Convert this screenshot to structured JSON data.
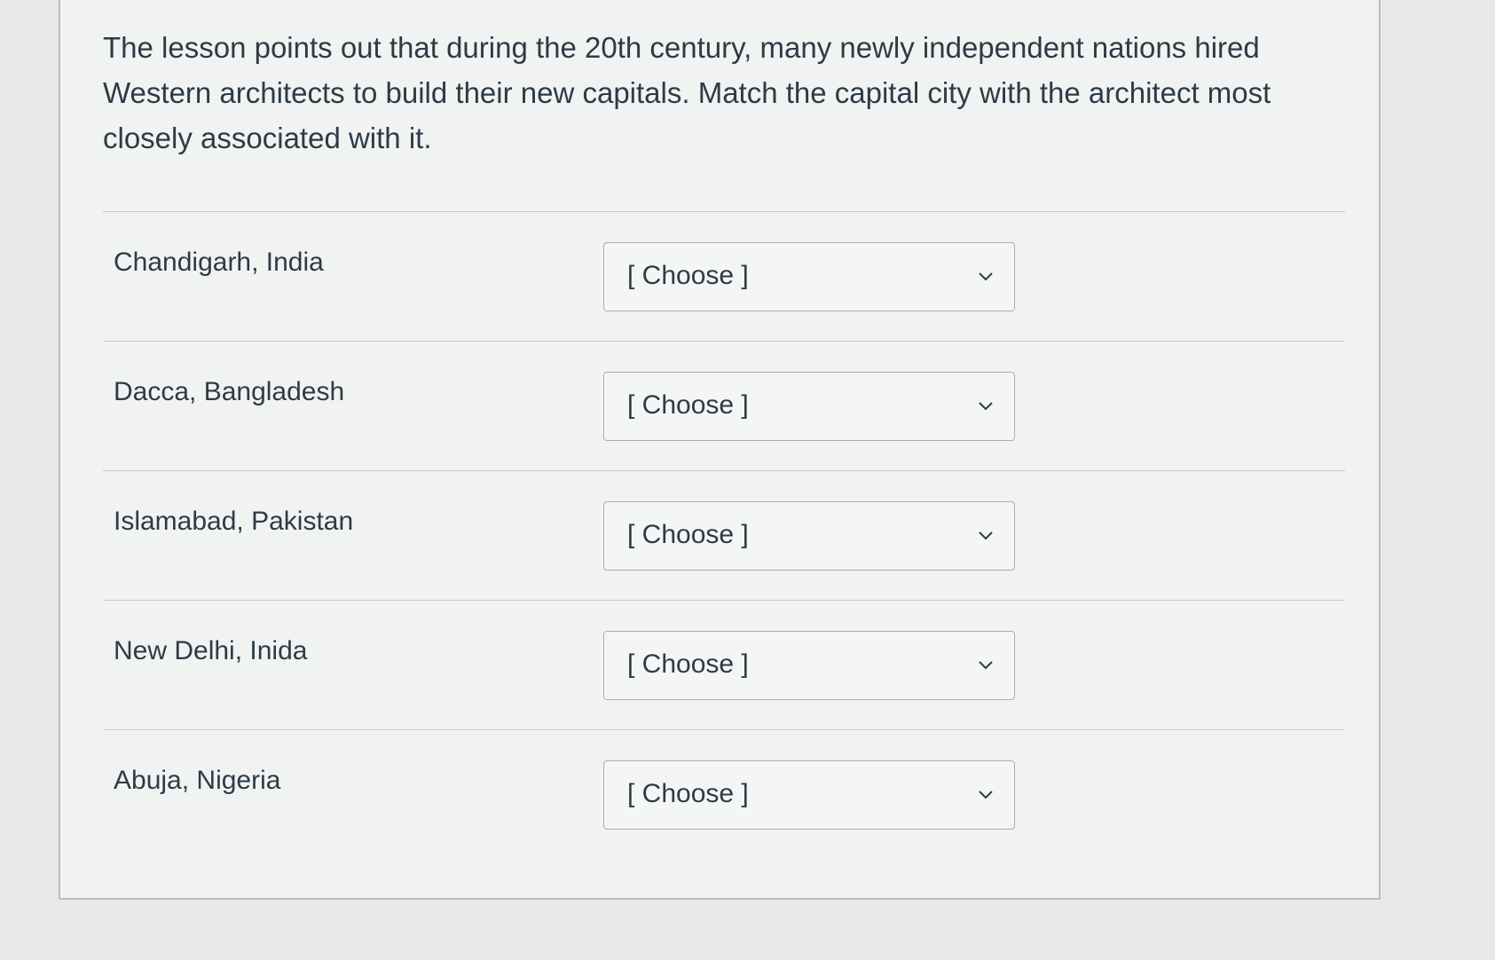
{
  "question": {
    "text": "The lesson points out that during the 20th century, many newly independent nations hired Western architects to build their new capitals. Match the capital city with the architect most closely associated with it."
  },
  "rows": [
    {
      "city": "Chandigarh, India",
      "select_value": "[ Choose ]"
    },
    {
      "city": "Dacca, Bangladesh",
      "select_value": "[ Choose ]"
    },
    {
      "city": "Islamabad, Pakistan",
      "select_value": "[ Choose ]"
    },
    {
      "city": "New Delhi, Inida",
      "select_value": "[ Choose ]"
    },
    {
      "city": "Abuja, Nigeria",
      "select_value": "[ Choose ]"
    }
  ],
  "icons": {
    "dropdown": "chevron-down-icon"
  }
}
